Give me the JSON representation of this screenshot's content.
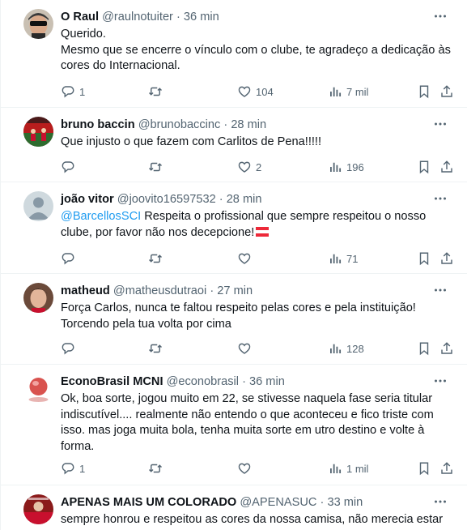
{
  "tweets": [
    {
      "name": "O Raul",
      "handle": "@raulnotuiter",
      "sep": "·",
      "time": "36 min",
      "lines": [
        "Querido.",
        "Mesmo que se encerre o vínculo com o clube, te agradeço a dedicação às cores do Internacional."
      ],
      "replies": "1",
      "retweets": "",
      "likes": "104",
      "views": "7 mil",
      "avatar": "avatar-man-sunglasses"
    },
    {
      "name": "bruno baccin",
      "handle": "@brunobaccinc",
      "sep": "·",
      "time": "28 min",
      "lines": [
        "Que injusto o que fazem com Carlitos de Pena!!!!!"
      ],
      "replies": "",
      "retweets": "",
      "likes": "2",
      "views": "196",
      "avatar": "avatar-stadium"
    },
    {
      "name": "joão vitor",
      "handle": "@joovito16597532",
      "sep": "·",
      "time": "28 min",
      "mention": "@BarcellosSCI",
      "lines": [
        " Respeita o profissional que sempre respeitou  o nosso clube, por favor não nos decepcione!"
      ],
      "replies": "",
      "retweets": "",
      "likes": "",
      "views": "71",
      "avatar": "avatar-default"
    },
    {
      "name": "matheud",
      "handle": "@matheusdutraoi",
      "sep": "·",
      "time": "27 min",
      "lines": [
        "Força Carlos, nunca te faltou respeito pelas cores e pela instituição!",
        "Torcendo pela tua volta por cima"
      ],
      "replies": "",
      "retweets": "",
      "likes": "",
      "views": "128",
      "avatar": "avatar-face"
    },
    {
      "name": "EconoBrasil MCNI",
      "handle": "@econobrasil",
      "sep": "·",
      "time": "36 min",
      "lines": [
        "Ok, boa sorte, jogou muito em 22, se stivesse naquela fase seria titular indiscutível.... realmente não entendo o que aconteceu e fico triste com isso. mas joga muita bola, tenha muita sorte em utro destino e volte à forma."
      ],
      "replies": "1",
      "retweets": "",
      "likes": "",
      "views": "1 mil",
      "avatar": "avatar-red-ball"
    },
    {
      "name": "APENAS MAIS UM COLORADO",
      "handle": "@APENASUC",
      "sep": "·",
      "time": "33 min",
      "lines": [
        "sempre honrou e respeitou as cores da nossa camisa, não merecia estar"
      ],
      "avatar": "avatar-colorado"
    }
  ],
  "colors": {
    "text": "#0f1419",
    "secondary": "#536471",
    "link": "#1d9bf0",
    "border": "#eff3f4"
  }
}
